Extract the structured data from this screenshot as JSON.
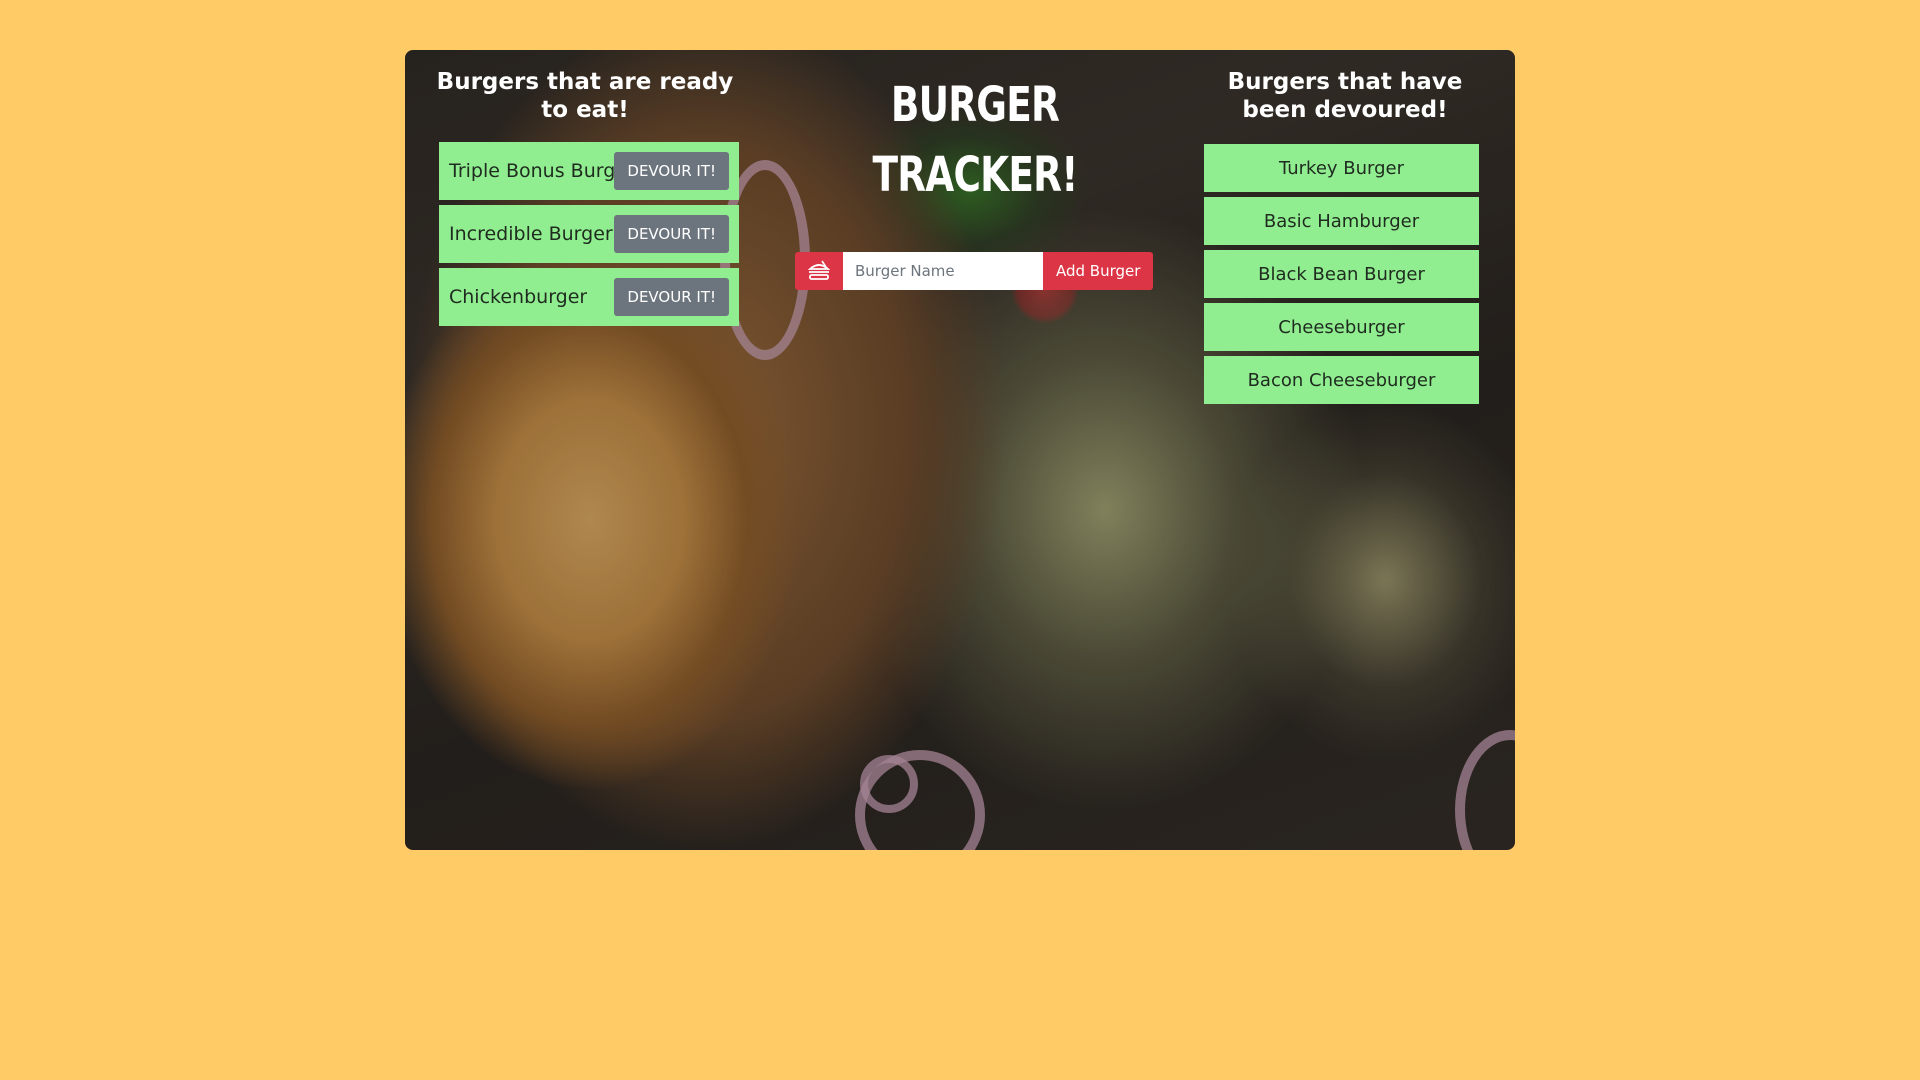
{
  "ready_column": {
    "heading": "Burgers that are ready to eat!",
    "items": [
      {
        "name": "Triple Bonus Burger",
        "button": "DEVOUR IT!"
      },
      {
        "name": "Incredible Burger",
        "button": "DEVOUR IT!"
      },
      {
        "name": "Chickenburger",
        "button": "DEVOUR IT!"
      }
    ]
  },
  "center": {
    "title": "BURGER TRACKER!",
    "input_icon": "burger-icon",
    "input_placeholder": "Burger Name",
    "input_value": "",
    "add_button": "Add Burger"
  },
  "devoured_column": {
    "heading": "Burgers that have been devoured!",
    "items": [
      "Turkey Burger",
      "Basic Hamburger",
      "Black Bean Burger",
      "Cheeseburger",
      "Bacon Cheeseburger"
    ]
  },
  "colors": {
    "page_background": "#FFCB66",
    "item_background": "#90EE90",
    "danger": "#dc3545",
    "secondary": "#6c757d"
  }
}
